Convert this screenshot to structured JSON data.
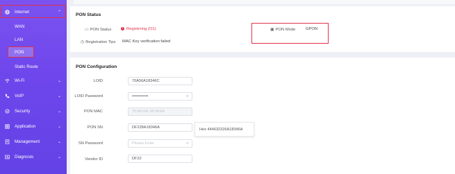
{
  "sidebar": {
    "internet": {
      "icon": "globe-icon",
      "label": "Internet"
    },
    "sub_items": [
      "WAN",
      "LAN",
      "PON",
      "Static Route"
    ],
    "items": [
      {
        "icon": "wifi-icon",
        "label": "Wi-Fi"
      },
      {
        "icon": "phone-icon",
        "label": "VoIP"
      },
      {
        "icon": "shield-icon",
        "label": "Security"
      },
      {
        "icon": "grid-icon",
        "label": "Application"
      },
      {
        "icon": "management-icon",
        "label": "Management"
      },
      {
        "icon": "diagnosis-icon",
        "label": "Diagnosis"
      }
    ],
    "accent": "#6f47ec",
    "highlight": "#e0304a"
  },
  "pon_status": {
    "title": "PON Status",
    "status_label": "PON Status",
    "status_value": "Registering (O1)",
    "tips_label": "Registration Tips",
    "tips_value": "MAC Key verification failed",
    "mode_label": "PON Mode",
    "mode_value": "GPON"
  },
  "pon_config": {
    "title": "PON Configuration",
    "loid_label": "LOID",
    "loid_value": "70A56A18346C",
    "loid_password_label": "LOID Password",
    "loid_password_value": "••••••••••••",
    "pon_mac_label": "PON MAC",
    "pon_mac_value": "70:A5:6A:18:34:6A",
    "pon_sn_label": "PON SN",
    "pon_sn_value": "DF228A18346A",
    "hex_text": "Hex 444632326A18346A",
    "sn_password_label": "SN Password",
    "sn_password_placeholder": "Please Enter",
    "vendor_id_label": "Vendor ID",
    "vendor_id_value": "DF22"
  }
}
